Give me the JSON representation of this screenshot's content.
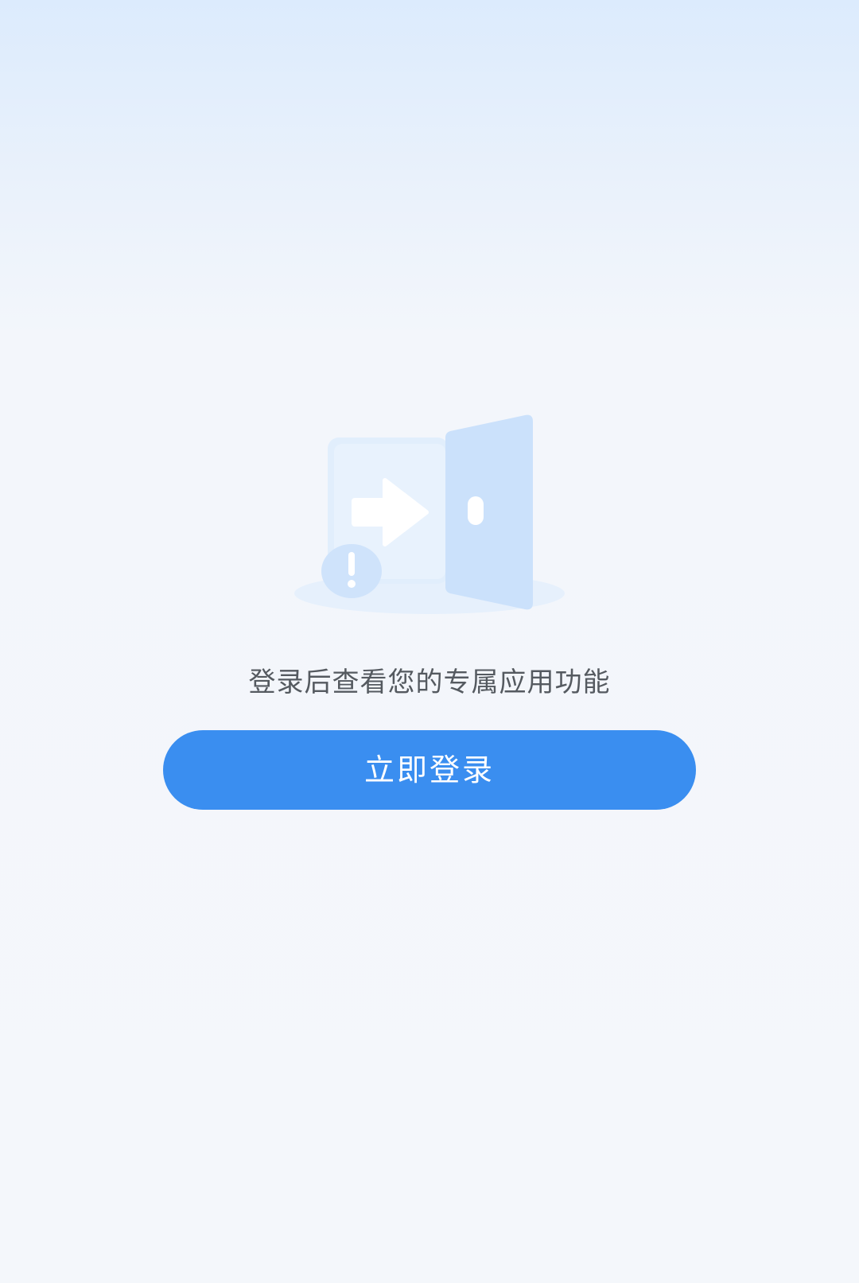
{
  "empty_state": {
    "illustration_icon": "door-login-arrow-icon",
    "alert_icon": "exclamation-icon",
    "message": "登录后查看您的专属应用功能"
  },
  "actions": {
    "login_label": "立即登录"
  },
  "colors": {
    "accent": "#3a8ef0",
    "text_secondary": "#555a60",
    "background_top": "#dcebfd",
    "background": "#f4f7fb"
  }
}
